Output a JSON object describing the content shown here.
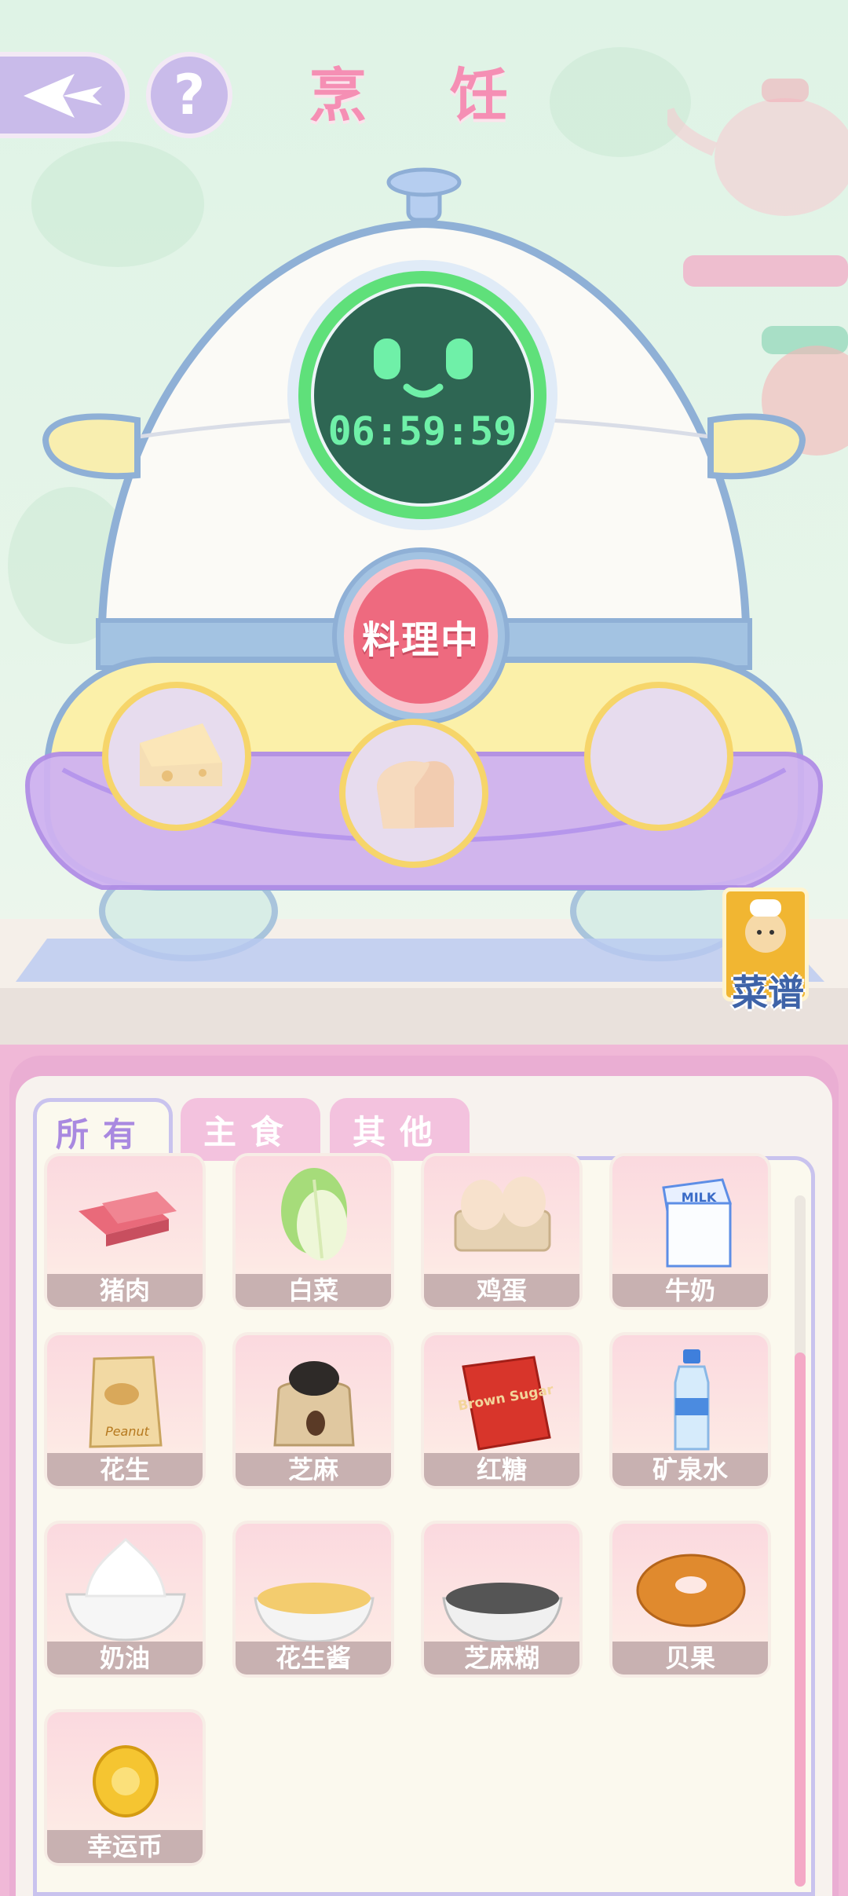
{
  "header": {
    "title": "烹 饪"
  },
  "timer": {
    "value": "06:59:59"
  },
  "cook_button": {
    "label": "料理中"
  },
  "slots": [
    {
      "content": "cheese-icon"
    },
    {
      "content": "bread-icon"
    },
    {
      "content": ""
    }
  ],
  "recipe": {
    "label": "菜谱"
  },
  "tabs": [
    {
      "label": "所有",
      "active": true
    },
    {
      "label": "主食",
      "active": false
    },
    {
      "label": "其他",
      "active": false
    }
  ],
  "items": [
    {
      "label": "猪肉",
      "icon": "pork-icon"
    },
    {
      "label": "白菜",
      "icon": "cabbage-icon"
    },
    {
      "label": "鸡蛋",
      "icon": "eggs-icon"
    },
    {
      "label": "牛奶",
      "icon": "milk-carton-icon",
      "art_text": "MILK"
    },
    {
      "label": "花生",
      "icon": "peanut-bag-icon",
      "art_text": "Peanut"
    },
    {
      "label": "芝麻",
      "icon": "sesame-sack-icon"
    },
    {
      "label": "红糖",
      "icon": "brown-sugar-bag-icon",
      "art_text": "Brown Sugar"
    },
    {
      "label": "矿泉水",
      "icon": "water-bottle-icon"
    },
    {
      "label": "奶油",
      "icon": "cream-bowl-icon"
    },
    {
      "label": "花生酱",
      "icon": "peanut-butter-bowl-icon"
    },
    {
      "label": "芝麻糊",
      "icon": "sesame-paste-bowl-icon"
    },
    {
      "label": "贝果",
      "icon": "bagel-icon"
    },
    {
      "label": "幸运币",
      "icon": "lucky-coin-icon"
    }
  ],
  "colors": {
    "title": "#f58fb4",
    "timer_ring": "#5fe07a",
    "cook_button": "#ee6a7f",
    "tab_active_text": "#a989e0",
    "tab_inactive_bg": "#f3c2de"
  }
}
